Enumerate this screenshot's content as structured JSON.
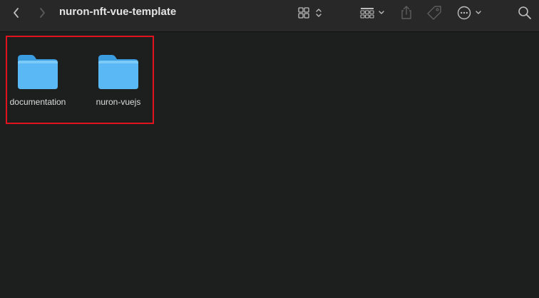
{
  "window": {
    "title": "nuron-nft-vue-template"
  },
  "toolbar": {
    "back_icon": "chevron-left-icon",
    "forward_icon": "chevron-right-icon",
    "view_mode_icon": "grid-view-icon",
    "group_icon": "group-by-icon",
    "share_icon": "share-icon",
    "tag_icon": "tag-icon",
    "more_icon": "ellipsis-circle-icon",
    "search_icon": "search-icon"
  },
  "items": [
    {
      "name": "documentation",
      "type": "folder"
    },
    {
      "name": "nuron-vuejs",
      "type": "folder"
    }
  ],
  "colors": {
    "background": "#1d1e1e",
    "toolbar": "#282828",
    "folder": "#5ab9f5",
    "highlight": "#e0131f"
  }
}
